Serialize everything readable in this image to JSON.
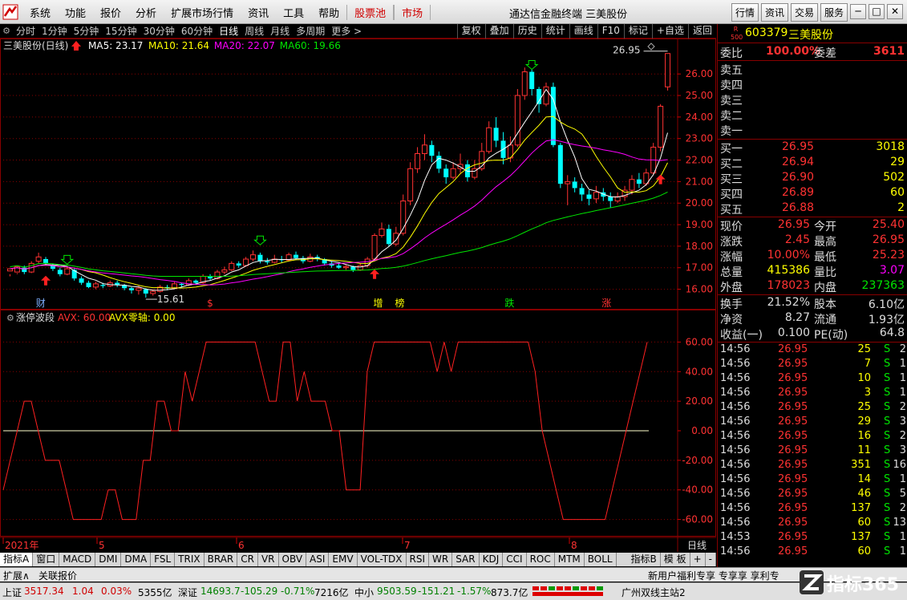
{
  "menu": {
    "items": [
      "系统",
      "功能",
      "报价",
      "分析",
      "扩展市场行情",
      "资讯",
      "工具",
      "帮助",
      "股票池",
      "市场"
    ],
    "window_title": "通达信金融终端  三美股份",
    "right_buttons": [
      "行情",
      "资讯",
      "交易",
      "服务"
    ],
    "win_controls": [
      "─",
      "□",
      "✕"
    ]
  },
  "periods": [
    "分时",
    "1分钟",
    "5分钟",
    "15分钟",
    "30分钟",
    "60分钟",
    "日线",
    "周线",
    "月线",
    "多周期",
    "更多 >"
  ],
  "active_period": "日线",
  "tools": [
    "复权",
    "叠加",
    "历史",
    "统计",
    "画线",
    "F10",
    "标记",
    "+自选",
    "返回"
  ],
  "chart": {
    "stock_title": "三美股份(日线)",
    "ma": [
      {
        "label": "MA5: 23.17",
        "color": "#ffffff"
      },
      {
        "label": "MA10: 21.64",
        "color": "#ffff00"
      },
      {
        "label": "MA20: 22.07",
        "color": "#ff00ff"
      },
      {
        "label": "MA60: 19.66",
        "color": "#00e600"
      }
    ],
    "max_label": "26.95",
    "min_label": "15.61",
    "price_ticks": [
      "26.00",
      "25.00",
      "24.00",
      "23.00",
      "22.00",
      "21.00",
      "20.00",
      "19.00",
      "18.00",
      "17.00",
      "16.00"
    ],
    "events": [
      {
        "label": "财",
        "color": "#7fb0ff",
        "pos": 0.06
      },
      {
        "label": "$",
        "color": "#ff3232",
        "pos": 0.31
      },
      {
        "label": "增",
        "color": "#ffff00",
        "pos": 0.558
      },
      {
        "label": "榜",
        "color": "#ffff00",
        "pos": 0.59
      },
      {
        "label": "跌",
        "color": "#00e600",
        "pos": 0.752
      },
      {
        "label": "涨",
        "color": "#ff3232",
        "pos": 0.895
      }
    ]
  },
  "indicator": {
    "name": "涨停波段",
    "avx": "AVX: 60.00",
    "zero": "AVX零轴: 0.00",
    "ticks": [
      "60.00",
      "40.00",
      "20.00",
      "0.00",
      "-20.00",
      "-40.00",
      "-60.00"
    ]
  },
  "xaxis": {
    "labels": [
      "2021年",
      "5",
      "6",
      "7",
      "8"
    ],
    "period_label": "日线"
  },
  "ind_tabs": [
    "指标A",
    "窗口",
    "MACD",
    "DMI",
    "DMA",
    "FSL",
    "TRIX",
    "BRAR",
    "CR",
    "VR",
    "OBV",
    "ASI",
    "EMV",
    "VOL-TDX",
    "RSI",
    "WR",
    "SAR",
    "KDJ",
    "CCI",
    "ROC",
    "MTM",
    "BOLL"
  ],
  "ind_right": [
    "指标B",
    "模 板",
    "+",
    "-"
  ],
  "ext": {
    "left": [
      "扩展∧",
      "关联报价"
    ],
    "links": "新用户福利专享 专享享 享利专"
  },
  "status": {
    "sh": {
      "name": "上证",
      "price": "3517.34",
      "chg": "1.04",
      "pct": "0.03%",
      "amt": "5355亿"
    },
    "sz": {
      "name": "深证",
      "price": "14693.7",
      "chg": "-105.29",
      "pct": "-0.71%",
      "amt": "7216亿"
    },
    "zx": {
      "name": "中小",
      "price": "9503.59",
      "chg": "-151.21",
      "pct": "-1.57%",
      "amt": "873.7亿"
    },
    "server": "广州双线主站2",
    "brand": "指标365"
  },
  "quote": {
    "badge": "R 500",
    "code": "603379",
    "name": "三美股份",
    "weibi_label": "委比",
    "weibi": "100.00%",
    "weicha_label": "委差",
    "weicha": "3611",
    "sells": [
      {
        "label": "卖五",
        "price": "",
        "vol": ""
      },
      {
        "label": "卖四",
        "price": "",
        "vol": ""
      },
      {
        "label": "卖三",
        "price": "",
        "vol": ""
      },
      {
        "label": "卖二",
        "price": "",
        "vol": ""
      },
      {
        "label": "卖一",
        "price": "",
        "vol": ""
      }
    ],
    "buys": [
      {
        "label": "买一",
        "price": "26.95",
        "vol": "3018"
      },
      {
        "label": "买二",
        "price": "26.94",
        "vol": "29"
      },
      {
        "label": "买三",
        "price": "26.90",
        "vol": "502"
      },
      {
        "label": "买四",
        "price": "26.89",
        "vol": "60"
      },
      {
        "label": "买五",
        "price": "26.88",
        "vol": "2"
      }
    ],
    "stats": [
      {
        "l1": "现价",
        "v1": "26.95",
        "c1": "c-red",
        "l2": "今开",
        "v2": "25.40",
        "c2": "c-red"
      },
      {
        "l1": "涨跌",
        "v1": "2.45",
        "c1": "c-red",
        "l2": "最高",
        "v2": "26.95",
        "c2": "c-red"
      },
      {
        "l1": "涨幅",
        "v1": "10.00%",
        "c1": "c-red",
        "l2": "最低",
        "v2": "25.23",
        "c2": "c-red"
      },
      {
        "l1": "总量",
        "v1": "415386",
        "c1": "c-yellow",
        "l2": "量比",
        "v2": "3.07",
        "c2": "c-mag"
      },
      {
        "l1": "外盘",
        "v1": "178023",
        "c1": "c-red",
        "l2": "内盘",
        "v2": "237363",
        "c2": "c-green"
      }
    ],
    "stats2": [
      {
        "l1": "换手",
        "v1": "21.52%",
        "l2": "股本",
        "v2": "6.10亿"
      },
      {
        "l1": "净资",
        "v1": "8.27",
        "l2": "流通",
        "v2": "1.93亿"
      },
      {
        "l1": "收益(一)",
        "v1": "0.100",
        "l2": "PE(动)",
        "v2": "64.8"
      }
    ],
    "ticks": [
      {
        "t": "14:56",
        "p": "26.95",
        "v": "25",
        "s": "S",
        "n": "2"
      },
      {
        "t": "14:56",
        "p": "26.95",
        "v": "7",
        "s": "S",
        "n": "1"
      },
      {
        "t": "14:56",
        "p": "26.95",
        "v": "10",
        "s": "S",
        "n": "1"
      },
      {
        "t": "14:56",
        "p": "26.95",
        "v": "3",
        "s": "S",
        "n": "1"
      },
      {
        "t": "14:56",
        "p": "26.95",
        "v": "25",
        "s": "S",
        "n": "2"
      },
      {
        "t": "14:56",
        "p": "26.95",
        "v": "29",
        "s": "S",
        "n": "3"
      },
      {
        "t": "14:56",
        "p": "26.95",
        "v": "16",
        "s": "S",
        "n": "2"
      },
      {
        "t": "14:56",
        "p": "26.95",
        "v": "11",
        "s": "S",
        "n": "3"
      },
      {
        "t": "14:56",
        "p": "26.95",
        "v": "351",
        "s": "S",
        "n": "16"
      },
      {
        "t": "14:56",
        "p": "26.95",
        "v": "14",
        "s": "S",
        "n": "1"
      },
      {
        "t": "14:56",
        "p": "26.95",
        "v": "46",
        "s": "S",
        "n": "5"
      },
      {
        "t": "14:56",
        "p": "26.95",
        "v": "137",
        "s": "S",
        "n": "2"
      },
      {
        "t": "14:56",
        "p": "26.95",
        "v": "60",
        "s": "S",
        "n": "13"
      },
      {
        "t": "14:53",
        "p": "26.95",
        "v": "137",
        "s": "S",
        "n": "1"
      },
      {
        "t": "14:56",
        "p": "26.95",
        "v": "60",
        "s": "S",
        "n": "1"
      }
    ]
  },
  "chart_data": [
    {
      "type": "candlestick",
      "title": "三美股份(日线)",
      "ylim": [
        15.5,
        27.2
      ],
      "xlabels": [
        "2021年",
        "5",
        "6",
        "7",
        "8"
      ],
      "candles": [
        [
          16.85,
          16.95,
          16.7,
          16.6
        ],
        [
          16.8,
          17.05,
          16.75,
          16.7
        ],
        [
          17.0,
          16.8,
          17.1,
          16.7
        ],
        [
          16.8,
          17.2,
          17.3,
          16.75
        ],
        [
          17.3,
          17.5,
          17.7,
          17.2
        ],
        [
          17.4,
          17.2,
          17.5,
          17.1
        ],
        [
          17.1,
          16.95,
          17.2,
          16.85
        ],
        [
          16.9,
          16.7,
          17.0,
          16.6
        ],
        [
          16.7,
          16.95,
          17.05,
          16.65
        ],
        [
          16.9,
          16.5,
          16.95,
          16.4
        ],
        [
          16.5,
          16.3,
          16.6,
          16.2
        ],
        [
          16.3,
          16.1,
          16.4,
          16.05
        ],
        [
          16.1,
          16.25,
          16.35,
          16.0
        ],
        [
          16.2,
          16.15,
          16.3,
          16.05
        ],
        [
          16.15,
          16.3,
          16.4,
          16.1
        ],
        [
          16.3,
          16.2,
          16.4,
          16.1
        ],
        [
          16.2,
          16.05,
          16.25,
          15.95
        ],
        [
          16.05,
          15.95,
          16.1,
          15.8
        ],
        [
          15.95,
          16.05,
          16.15,
          15.75
        ],
        [
          16.0,
          15.8,
          16.05,
          15.61
        ],
        [
          15.8,
          15.9,
          16.0,
          15.7
        ],
        [
          15.9,
          16.1,
          16.2,
          15.85
        ],
        [
          16.1,
          16.05,
          16.2,
          15.95
        ],
        [
          16.05,
          16.25,
          16.35,
          16.0
        ],
        [
          16.25,
          16.2,
          16.3,
          16.1
        ],
        [
          16.2,
          16.4,
          16.5,
          16.15
        ],
        [
          16.4,
          16.3,
          16.45,
          16.2
        ],
        [
          16.3,
          16.6,
          16.7,
          16.25
        ],
        [
          16.6,
          16.5,
          16.7,
          16.4
        ],
        [
          16.5,
          16.8,
          16.9,
          16.45
        ],
        [
          16.8,
          16.9,
          17.05,
          16.7
        ],
        [
          16.9,
          17.2,
          17.3,
          16.85
        ],
        [
          17.2,
          17.1,
          17.3,
          17.0
        ],
        [
          17.1,
          17.4,
          17.5,
          17.05
        ],
        [
          17.4,
          17.6,
          17.8,
          17.3
        ],
        [
          17.6,
          17.3,
          17.7,
          17.2
        ],
        [
          17.3,
          17.25,
          17.45,
          17.15
        ],
        [
          17.25,
          17.4,
          17.6,
          17.2
        ],
        [
          17.4,
          17.35,
          17.55,
          17.25
        ],
        [
          17.35,
          17.6,
          17.7,
          17.3
        ],
        [
          17.6,
          17.45,
          17.75,
          17.35
        ],
        [
          17.45,
          17.3,
          17.55,
          17.2
        ],
        [
          17.3,
          17.5,
          17.65,
          17.25
        ],
        [
          17.5,
          17.4,
          17.6,
          17.3
        ],
        [
          17.4,
          17.2,
          17.45,
          17.1
        ],
        [
          17.2,
          17.1,
          17.3,
          17.0
        ],
        [
          17.1,
          17.0,
          17.2,
          16.95
        ],
        [
          17.0,
          17.05,
          17.15,
          16.9
        ],
        [
          17.05,
          16.9,
          17.1,
          16.8
        ],
        [
          16.9,
          17.1,
          17.2,
          16.85
        ],
        [
          17.1,
          17.4,
          17.5,
          17.0
        ],
        [
          17.4,
          18.5,
          18.6,
          17.4
        ],
        [
          18.5,
          18.8,
          19.1,
          18.4
        ],
        [
          18.8,
          18.1,
          19.0,
          18.0
        ],
        [
          18.1,
          18.6,
          18.9,
          18.0
        ],
        [
          18.6,
          20.1,
          20.4,
          18.5
        ],
        [
          20.1,
          21.6,
          21.9,
          19.9
        ],
        [
          21.6,
          22.3,
          22.6,
          21.4
        ],
        [
          22.3,
          22.7,
          23.2,
          22.0
        ],
        [
          22.7,
          22.2,
          22.9,
          21.9
        ],
        [
          22.2,
          21.6,
          22.4,
          21.4
        ],
        [
          21.6,
          21.2,
          21.8,
          20.9
        ],
        [
          21.2,
          21.6,
          21.9,
          21.1
        ],
        [
          21.6,
          21.8,
          22.3,
          21.4
        ],
        [
          21.8,
          21.2,
          22.0,
          21.0
        ],
        [
          21.2,
          21.6,
          22.0,
          21.1
        ],
        [
          21.6,
          22.4,
          22.8,
          21.5
        ],
        [
          22.4,
          23.5,
          23.8,
          22.3
        ],
        [
          23.5,
          22.9,
          24.0,
          22.6
        ],
        [
          22.9,
          22.1,
          23.3,
          21.8
        ],
        [
          22.1,
          22.7,
          23.1,
          21.9
        ],
        [
          22.7,
          25.0,
          25.3,
          22.6
        ],
        [
          25.0,
          26.1,
          26.3,
          24.8
        ],
        [
          26.1,
          25.3,
          26.2,
          25.0
        ],
        [
          25.3,
          24.6,
          25.4,
          24.2
        ],
        [
          24.6,
          25.4,
          25.6,
          24.5
        ],
        [
          25.4,
          22.7,
          25.6,
          22.6
        ],
        [
          22.7,
          20.9,
          22.8,
          20.7
        ],
        [
          20.9,
          21.0,
          21.3,
          19.9
        ],
        [
          21.0,
          20.7,
          21.2,
          20.5
        ],
        [
          20.7,
          20.4,
          20.9,
          20.1
        ],
        [
          20.4,
          20.2,
          20.6,
          19.9
        ],
        [
          20.2,
          20.5,
          20.8,
          20.0
        ],
        [
          20.5,
          20.3,
          20.7,
          20.1
        ],
        [
          20.3,
          20.1,
          20.5,
          19.8
        ],
        [
          20.1,
          20.3,
          20.5,
          20.0
        ],
        [
          20.3,
          20.6,
          20.8,
          20.1
        ],
        [
          20.6,
          21.1,
          21.3,
          20.4
        ],
        [
          21.1,
          20.9,
          21.4,
          20.7
        ],
        [
          20.9,
          21.4,
          21.6,
          20.8
        ],
        [
          21.4,
          22.6,
          22.8,
          21.3
        ],
        [
          22.6,
          24.5,
          24.6,
          22.4
        ],
        [
          25.4,
          26.95,
          26.95,
          25.23
        ]
      ],
      "series": [
        {
          "name": "MA5",
          "color": "#ffffff"
        },
        {
          "name": "MA10",
          "color": "#ffff00"
        },
        {
          "name": "MA20",
          "color": "#ff00ff"
        },
        {
          "name": "MA60",
          "color": "#00e600"
        }
      ]
    },
    {
      "type": "line",
      "title": "涨停波段",
      "ylim": [
        -70,
        70
      ],
      "series": [
        {
          "name": "AVX",
          "color": "#ff2020",
          "values": [
            -40,
            -20,
            0,
            20,
            20,
            0,
            -20,
            -20,
            -20,
            -40,
            -60,
            -60,
            -60,
            -60,
            -60,
            -40,
            -40,
            -60,
            -60,
            -60,
            -20,
            -20,
            20,
            20,
            0,
            0,
            40,
            20,
            40,
            60,
            60,
            60,
            60,
            60,
            60,
            60,
            60,
            40,
            20,
            20,
            60,
            60,
            20,
            40,
            20,
            20,
            20,
            0,
            0,
            -40,
            -40,
            -40,
            40,
            60,
            60,
            60,
            60,
            60,
            60,
            60,
            60,
            60,
            40,
            60,
            40,
            60,
            60,
            60,
            60,
            60,
            60,
            60,
            60,
            60,
            60,
            60,
            40,
            0,
            -20,
            -40,
            -60,
            -60,
            -60,
            -60,
            -60,
            -60,
            -60,
            -40,
            -20,
            0,
            20,
            40,
            60
          ]
        }
      ]
    }
  ]
}
